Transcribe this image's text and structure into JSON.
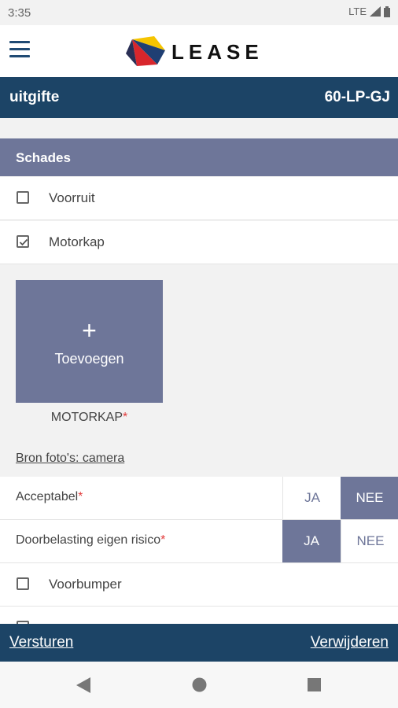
{
  "status": {
    "time": "3:35",
    "network": "LTE"
  },
  "appbar": {
    "logo_text": "LEASE",
    "menu_icon": "hamburger-menu-icon"
  },
  "header": {
    "left": "uitgifte",
    "right": "60-LP-GJ"
  },
  "section": {
    "title": "Schades"
  },
  "damage_items": [
    {
      "label": "Voorruit",
      "checked": false
    },
    {
      "label": "Motorkap",
      "checked": true
    },
    {
      "label": "Voorbumper",
      "checked": false
    }
  ],
  "photo": {
    "add_label": "Toevoegen",
    "plus": "+",
    "caption": "MOTORKAP",
    "required_mark": "*",
    "source_link": "Bron foto's: camera"
  },
  "questions": [
    {
      "label": "Acceptabel",
      "required_mark": "*",
      "yes": "JA",
      "no": "NEE",
      "selected": "NEE"
    },
    {
      "label": "Doorbelasting eigen risico",
      "required_mark": "*",
      "yes": "JA",
      "no": "NEE",
      "selected": "JA"
    }
  ],
  "footer": {
    "send": "Versturen",
    "delete": "Verwijderen"
  },
  "colors": {
    "primary": "#1c4466",
    "accent": "#6e7699",
    "required": "#e23b3b"
  }
}
